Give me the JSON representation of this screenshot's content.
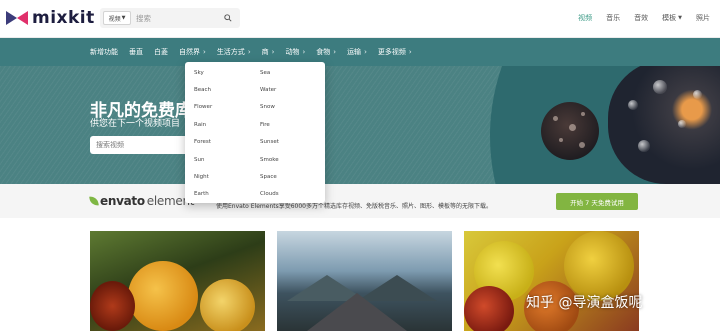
{
  "header": {
    "logo_text": "mixkit",
    "search": {
      "type_selected": "视频",
      "placeholder": "搜索"
    },
    "nav": [
      {
        "label": "视频",
        "active": true
      },
      {
        "label": "音乐",
        "active": false
      },
      {
        "label": "音效",
        "active": false
      },
      {
        "label": "模板",
        "active": false,
        "has_dropdown": true
      },
      {
        "label": "照片",
        "active": false
      }
    ]
  },
  "categories": [
    {
      "label": "新增功能",
      "has_chevron": false
    },
    {
      "label": "垂直",
      "has_chevron": false
    },
    {
      "label": "白菱",
      "has_chevron": false
    },
    {
      "label": "自然界",
      "has_chevron": true
    },
    {
      "label": "生活方式",
      "has_chevron": true
    },
    {
      "label": "商",
      "has_chevron": true
    },
    {
      "label": "动物",
      "has_chevron": true
    },
    {
      "label": "食物",
      "has_chevron": true
    },
    {
      "label": "运输",
      "has_chevron": true
    },
    {
      "label": "更多视频",
      "has_chevron": true
    }
  ],
  "dropdown": {
    "col1": [
      "Sky",
      "Beach",
      "Flower",
      "Rain",
      "Forest",
      "Sun",
      "Night",
      "Earth"
    ],
    "col2": [
      "Sea",
      "Water",
      "Snow",
      "Fire",
      "Sunset",
      "Smoke",
      "Space",
      "Clouds"
    ]
  },
  "hero": {
    "title": "非凡的免费库",
    "subtitle": "供您在下一个视频项目",
    "search_placeholder": "搜索视频"
  },
  "envato": {
    "logo_bold": "envato",
    "logo_light": "element",
    "text": "使用Envato Elements享受6000多万个精选库存视频、免版税音乐、照片、图形、模板等的无限下载。",
    "button_label": "开始 7 天免费试用"
  },
  "watermark": "知乎 @导演盒饭呢",
  "colors": {
    "teal_bar": "#3d7c7f",
    "hero": "#4b8283",
    "accent_green": "#82b541",
    "active_nav": "#3b9a86"
  }
}
